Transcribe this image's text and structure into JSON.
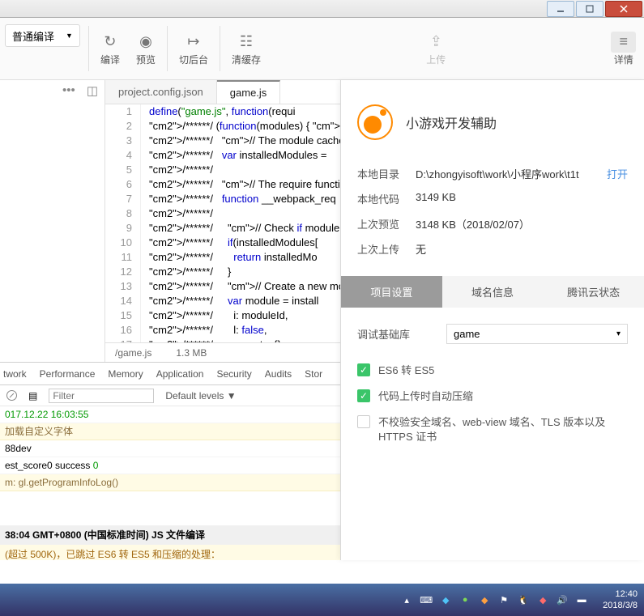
{
  "toolbar": {
    "mode": "普通编译",
    "compile": "编译",
    "preview": "预览",
    "back": "切后台",
    "clear": "清缓存",
    "upload": "上传",
    "details": "详情"
  },
  "rail": {
    "more": "•••"
  },
  "tabs": {
    "t0": "project.config.json",
    "t1": "game.js"
  },
  "code": {
    "lines": [
      {
        "n": "1",
        "t": "define(\"game.js\", function(requi"
      },
      {
        "n": "2",
        "t": "/******/ (function(modules) { //"
      },
      {
        "n": "3",
        "t": "/******/   // The module cache"
      },
      {
        "n": "4",
        "t": "/******/   var installedModules ="
      },
      {
        "n": "5",
        "t": "/******/"
      },
      {
        "n": "6",
        "t": "/******/   // The require functio"
      },
      {
        "n": "7",
        "t": "/******/   function __webpack_req"
      },
      {
        "n": "8",
        "t": "/******/"
      },
      {
        "n": "9",
        "t": "/******/     // Check if module i"
      },
      {
        "n": "10",
        "t": "/******/     if(installedModules["
      },
      {
        "n": "11",
        "t": "/******/       return installedMo"
      },
      {
        "n": "12",
        "t": "/******/     }"
      },
      {
        "n": "13",
        "t": "/******/     // Create a new modu"
      },
      {
        "n": "14",
        "t": "/******/     var module = install"
      },
      {
        "n": "15",
        "t": "/******/       i: moduleId,"
      },
      {
        "n": "16",
        "t": "/******/       l: false,"
      },
      {
        "n": "17",
        "t": "/******/       exports: {}"
      }
    ]
  },
  "status": {
    "path": "/game.js",
    "size": "1.3 MB"
  },
  "devtools": {
    "tabs": {
      "network": "twork",
      "perf": "Performance",
      "memory": "Memory",
      "app": "Application",
      "sec": "Security",
      "audits": "Audits",
      "stor": "Stor"
    },
    "filter_ph": "Filter",
    "levels": "Default levels ▼",
    "console": {
      "ts": "017.12.22 16:03:55",
      "warn1": "加载自定义字体",
      "ctx": " 88dev",
      "ok": "est_score0 success ",
      "ok_val": "0",
      "gl": "m: gl.getProgramInfoLog()",
      "build_hdr": "38:04 GMT+0800 (中国标准时间) JS 文件编译",
      "build_warn": "(超过 500K)，已跳过 ES6 转 ES5 和压缩的处理："
    }
  },
  "panel": {
    "title": "小游戏开发辅助",
    "rows": {
      "dir_l": "本地目录",
      "dir_v": "D:\\zhongyisoft\\work\\小程序work\\t1t",
      "open": "打开",
      "code_l": "本地代码",
      "code_v": "3149 KB",
      "prev_l": "上次预览",
      "prev_v": "3148 KB（2018/02/07）",
      "up_l": "上次上传",
      "up_v": "无"
    },
    "tabs": {
      "t0": "项目设置",
      "t1": "域名信息",
      "t2": "腾讯云状态"
    },
    "lib_label": "调试基础库",
    "lib_value": "game",
    "chk1": "ES6 转 ES5",
    "chk2": "代码上传时自动压缩",
    "chk3": "不校验安全域名、web-view 域名、TLS 版本以及 HTTPS 证书"
  },
  "taskbar": {
    "time": "12:40",
    "date": "2018/3/8"
  }
}
